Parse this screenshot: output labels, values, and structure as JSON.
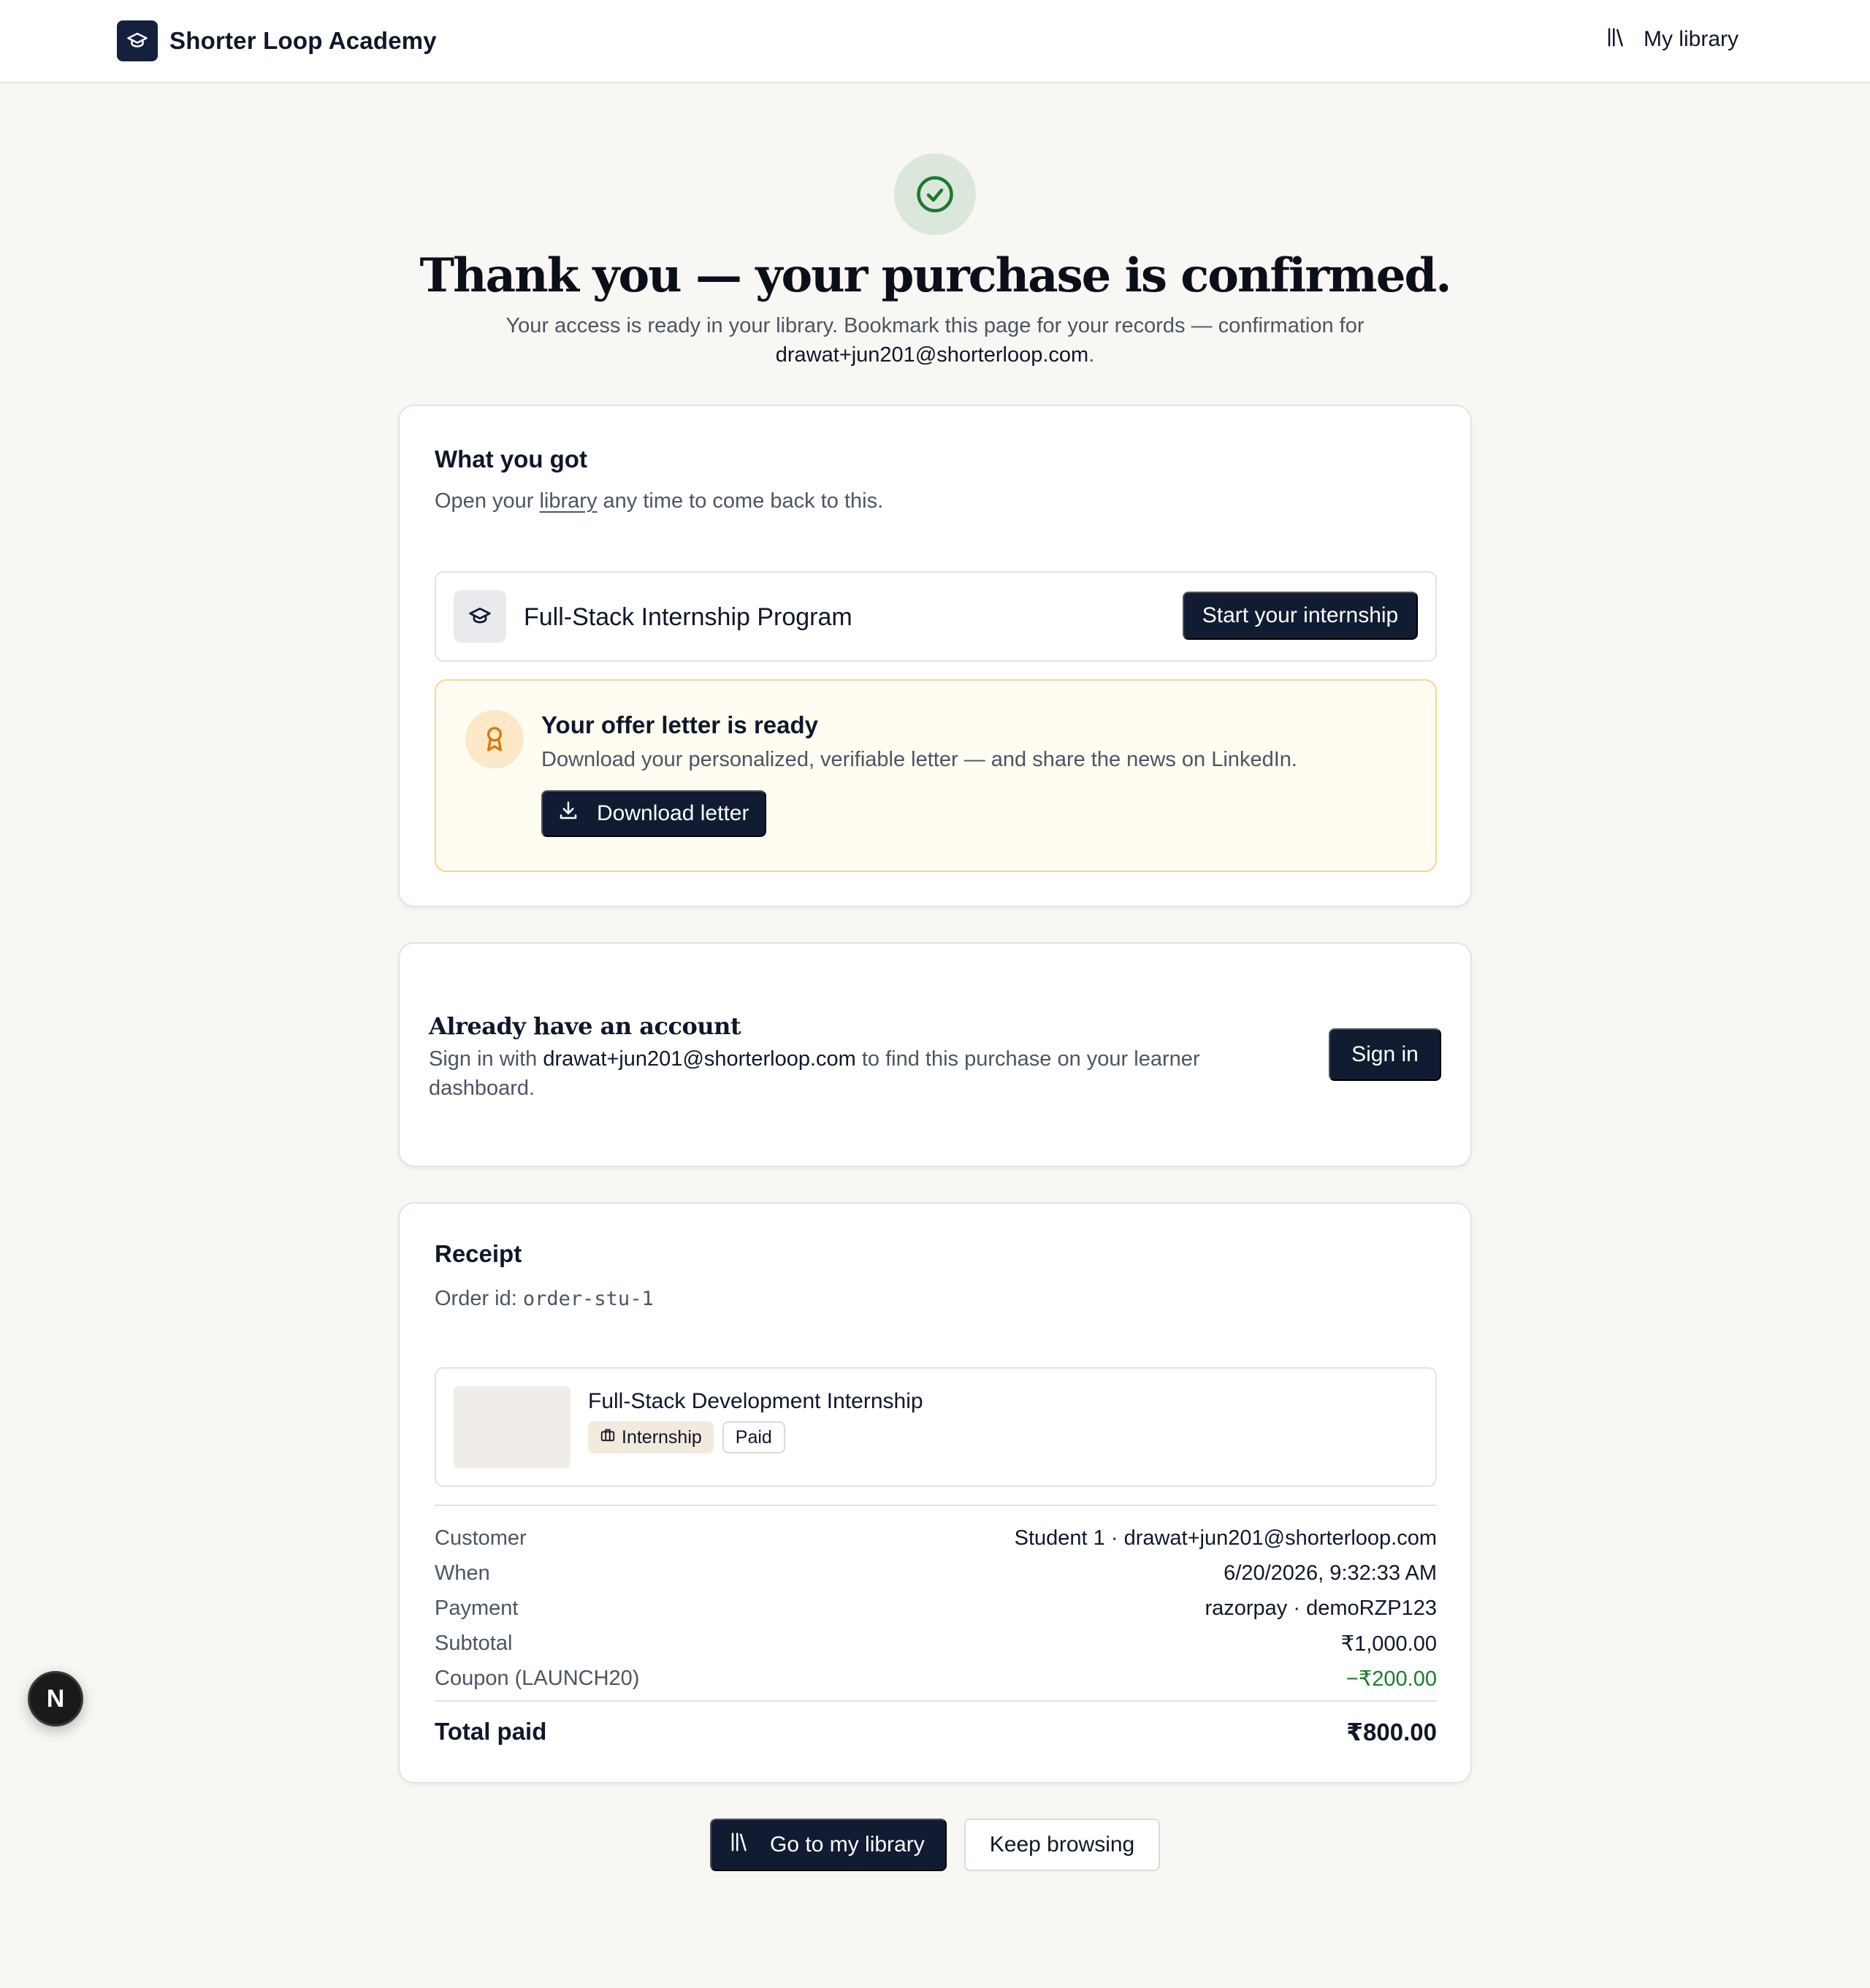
{
  "header": {
    "brand": "Shorter Loop Academy",
    "my_library": "My library",
    "icons": [
      "graduation-cap-icon",
      "library-icon"
    ]
  },
  "hero": {
    "title": "Thank you — your purchase is confirmed.",
    "subtitle_prefix": "Your access is ready in your library. Bookmark this page for your records — confirmation for",
    "email": "drawat+jun201@shorterloop.com",
    "subtitle_suffix": "."
  },
  "what_you_got": {
    "title": "What you got",
    "subtitle_before": "Open your",
    "subtitle_link": "library",
    "subtitle_after": "any time to come back to this.",
    "product_name": "Full-Stack Internship Program",
    "product_button": "Start your internship",
    "offer": {
      "title": "Your offer letter is ready",
      "description": "Download your personalized, verifiable letter — and share the news on LinkedIn.",
      "button": "Download letter"
    }
  },
  "account": {
    "title": "Already have an account",
    "text_before": "Sign in with",
    "email": "drawat+jun201@shorterloop.com",
    "text_after": "to find this purchase on your learner dashboard.",
    "button": "Sign in"
  },
  "receipt": {
    "title": "Receipt",
    "order_label": "Order id:",
    "order_id": "order-stu-1",
    "item": {
      "name": "Full-Stack Development Internship",
      "tag_type": "Internship",
      "tag_status": "Paid"
    },
    "lines": [
      {
        "key": "Customer",
        "value": "Student 1 · drawat+jun201@shorterloop.com",
        "color": "#0f172a"
      },
      {
        "key": "When",
        "value": "6/20/2026, 9:32:33 AM",
        "color": "#0f172a"
      },
      {
        "key": "Payment",
        "value": "razorpay · demoRZP123",
        "color": "#0f172a"
      },
      {
        "key": "Subtotal",
        "value": "₹1,000.00",
        "color": "#0f172a"
      },
      {
        "key": "Coupon (LAUNCH20)",
        "value": "−₹200.00",
        "color": "#1b7a2e"
      }
    ],
    "total_label": "Total paid",
    "total_value": "₹800.00"
  },
  "actions": {
    "go_library": "Go to my library",
    "keep_browsing": "Keep browsing"
  },
  "dev_badge": "N",
  "colors": {
    "navy": "#111c33",
    "success_green": "#1b7a2e",
    "offer_border": "#f2d98a",
    "background": "#f8f7f4"
  }
}
